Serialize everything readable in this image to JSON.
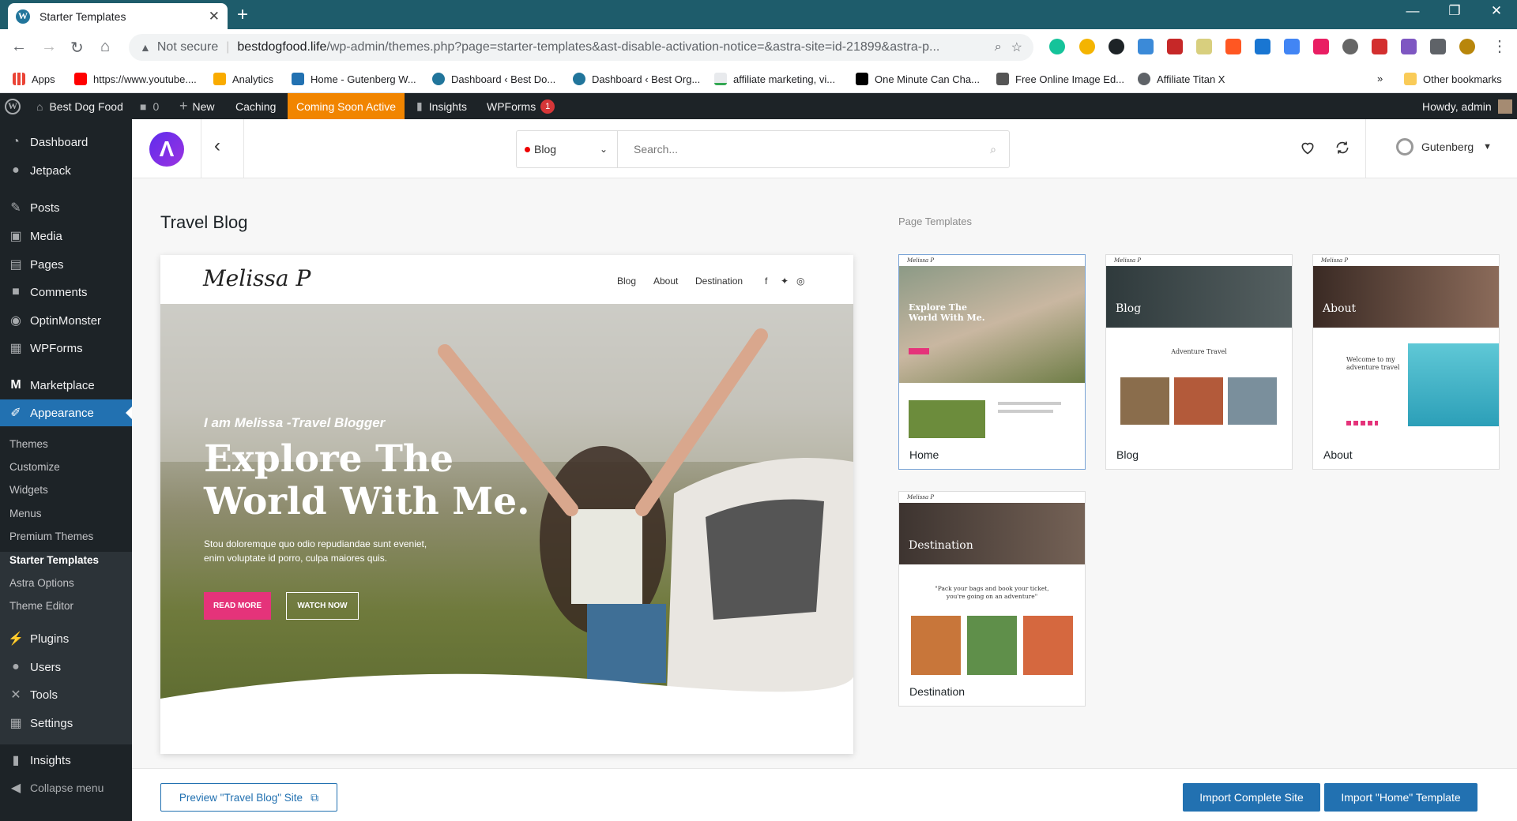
{
  "browser": {
    "tab_title": "Starter Templates",
    "url_host": "bestdogfood.life",
    "url_path": "/wp-admin/themes.php?page=starter-templates&ast-disable-activation-notice=&astra-site=id-21899&astra-p...",
    "security_label": "Not secure"
  },
  "bookmarks": [
    {
      "label": "Apps",
      "icon": "apps-grid-icon"
    },
    {
      "label": "https://www.youtube....",
      "icon": "youtube-icon"
    },
    {
      "label": "Analytics",
      "icon": "analytics-icon"
    },
    {
      "label": "Home - Gutenberg W...",
      "icon": "gutenberg-icon"
    },
    {
      "label": "Dashboard ‹ Best Do...",
      "icon": "wordpress-icon"
    },
    {
      "label": "Dashboard ‹ Best Org...",
      "icon": "wordpress-icon"
    },
    {
      "label": "affiliate marketing, vi...",
      "icon": "trend-icon"
    },
    {
      "label": "One Minute Can Cha...",
      "icon": "medium-icon"
    },
    {
      "label": "Free Online Image Ed...",
      "icon": "pixlr-icon"
    },
    {
      "label": "Affiliate Titan X",
      "icon": "globe-icon"
    }
  ],
  "bookmarks_more": "»",
  "other_bookmarks": "Other bookmarks",
  "adminbar": {
    "site_name": "Best Dog Food",
    "comments_count": "0",
    "new_label": "New",
    "caching_label": "Caching",
    "coming_soon_label": "Coming Soon Active",
    "insights_label": "Insights",
    "wpforms_label": "WPForms",
    "wpforms_badge": "1",
    "howdy": "Howdy, admin"
  },
  "sidebar": {
    "items": [
      {
        "label": "Dashboard",
        "icon": "dashboard-icon"
      },
      {
        "label": "Jetpack",
        "icon": "jetpack-icon"
      },
      {
        "label": "Posts",
        "icon": "pin-icon"
      },
      {
        "label": "Media",
        "icon": "media-icon"
      },
      {
        "label": "Pages",
        "icon": "pages-icon"
      },
      {
        "label": "Comments",
        "icon": "comment-icon"
      },
      {
        "label": "OptinMonster",
        "icon": "optinmonster-icon"
      },
      {
        "label": "WPForms",
        "icon": "wpforms-icon"
      },
      {
        "label": "Marketplace",
        "icon": "marketplace-icon"
      },
      {
        "label": "Appearance",
        "icon": "brush-icon"
      },
      {
        "label": "Plugins",
        "icon": "plugin-icon"
      },
      {
        "label": "Users",
        "icon": "users-icon"
      },
      {
        "label": "Tools",
        "icon": "wrench-icon"
      },
      {
        "label": "Settings",
        "icon": "settings-icon"
      },
      {
        "label": "Insights",
        "icon": "insights-icon"
      },
      {
        "label": "Collapse menu",
        "icon": "collapse-icon"
      }
    ],
    "submenu": [
      "Themes",
      "Customize",
      "Widgets",
      "Menus",
      "Premium Themes",
      "Starter Templates",
      "Astra Options",
      "Theme Editor"
    ]
  },
  "toolbar": {
    "category": "Blog",
    "search_placeholder": "Search...",
    "builder": "Gutenberg"
  },
  "page_title": "Travel Blog",
  "preview": {
    "logo": "Melissa P",
    "nav": [
      "Blog",
      "About",
      "Destination"
    ],
    "kicker": "I am Melissa -Travel Blogger",
    "headline": "Explore The World With Me.",
    "body": "Stou doloremque quo odio repudiandae sunt eveniet, enim voluptate id porro, culpa maiores quis.",
    "read_more": "READ MORE",
    "watch_now": "WATCH NOW"
  },
  "page_templates_label": "Page Templates",
  "templates": [
    {
      "name": "Home",
      "banner": "Explore The World With Me."
    },
    {
      "name": "Blog",
      "banner": "Blog",
      "heading": "Adventure Travel"
    },
    {
      "name": "About",
      "banner": "About",
      "heading": "Welcome to my adventure travel"
    },
    {
      "name": "Destination",
      "banner": "Destination",
      "quote": "\"Pack your bags and book your ticket, you're going on an adventure\""
    }
  ],
  "footer": {
    "preview_btn": "Preview \"Travel Blog\" Site",
    "import_site_btn": "Import Complete Site",
    "import_template_btn": "Import \"Home\" Template"
  },
  "colors": {
    "wp_blue": "#2271b1",
    "admin_dark": "#1d2327",
    "coming_soon": "#f18500",
    "pink": "#e5337a"
  }
}
